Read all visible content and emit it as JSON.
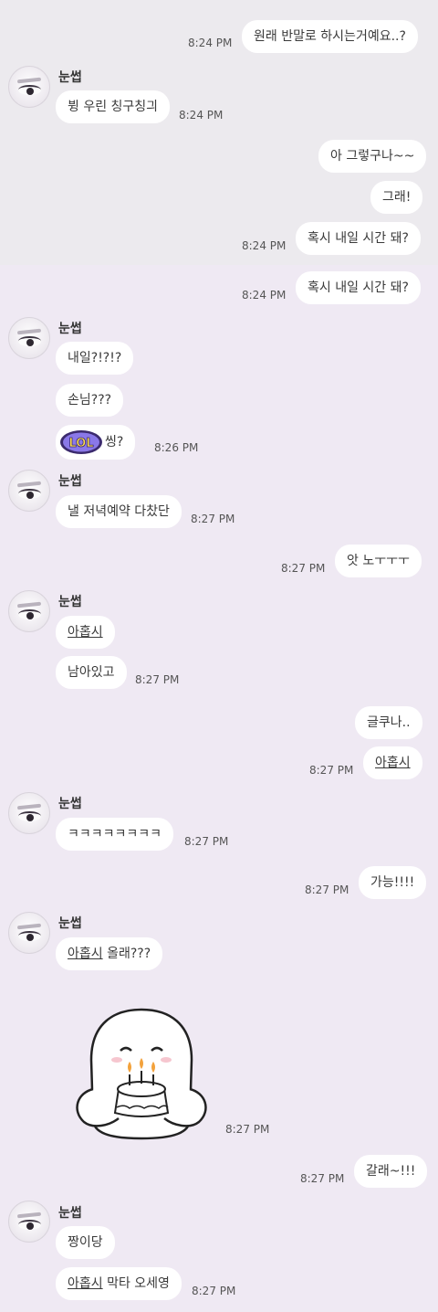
{
  "contact": {
    "name": "눈썹"
  },
  "msgs": {
    "m1": {
      "text": "원래 반말로 하시는거예요..?",
      "time": "8:24 PM"
    },
    "m2": {
      "text": "뷩 우린 칭구칭긔",
      "time": "8:24 PM"
    },
    "m3": {
      "text": "아 그렇구나~~"
    },
    "m4": {
      "text": "그래!"
    },
    "m5": {
      "text": "혹시 내일 시간 돼?",
      "time": "8:24 PM"
    },
    "m6": {
      "text": "혹시 내일 시간 돼?",
      "time": "8:24 PM"
    },
    "m7": {
      "text": "내일?!?!?"
    },
    "m8": {
      "text": "손님???"
    },
    "m9": {
      "sticker_text": "LOL",
      "text": "씽?",
      "time": "8:26 PM"
    },
    "m10": {
      "text": "낼 저녁예약 다찼단",
      "time": "8:27 PM"
    },
    "m11": {
      "text": "앗 노ㅜㅜㅜ",
      "time": "8:27 PM"
    },
    "m12": {
      "text": "아홉시"
    },
    "m13": {
      "text": "남아있고",
      "time": "8:27 PM"
    },
    "m14": {
      "text": "글쿠나.."
    },
    "m15": {
      "text": "아홉시",
      "time": "8:27 PM"
    },
    "m16": {
      "text": "ㅋㅋㅋㅋㅋㅋㅋㅋ",
      "time": "8:27 PM"
    },
    "m17": {
      "text": "가능!!!!",
      "time": "8:27 PM"
    },
    "m18": {
      "link": "아홉시",
      "text": " 올래???"
    },
    "m19": {
      "time": "8:27 PM"
    },
    "m20": {
      "text": "갈래~!!!",
      "time": "8:27 PM"
    },
    "m21": {
      "text": "짱이당"
    },
    "m22": {
      "link": "아홉시",
      "text": " 막타 오세영",
      "time": "8:27 PM"
    }
  }
}
